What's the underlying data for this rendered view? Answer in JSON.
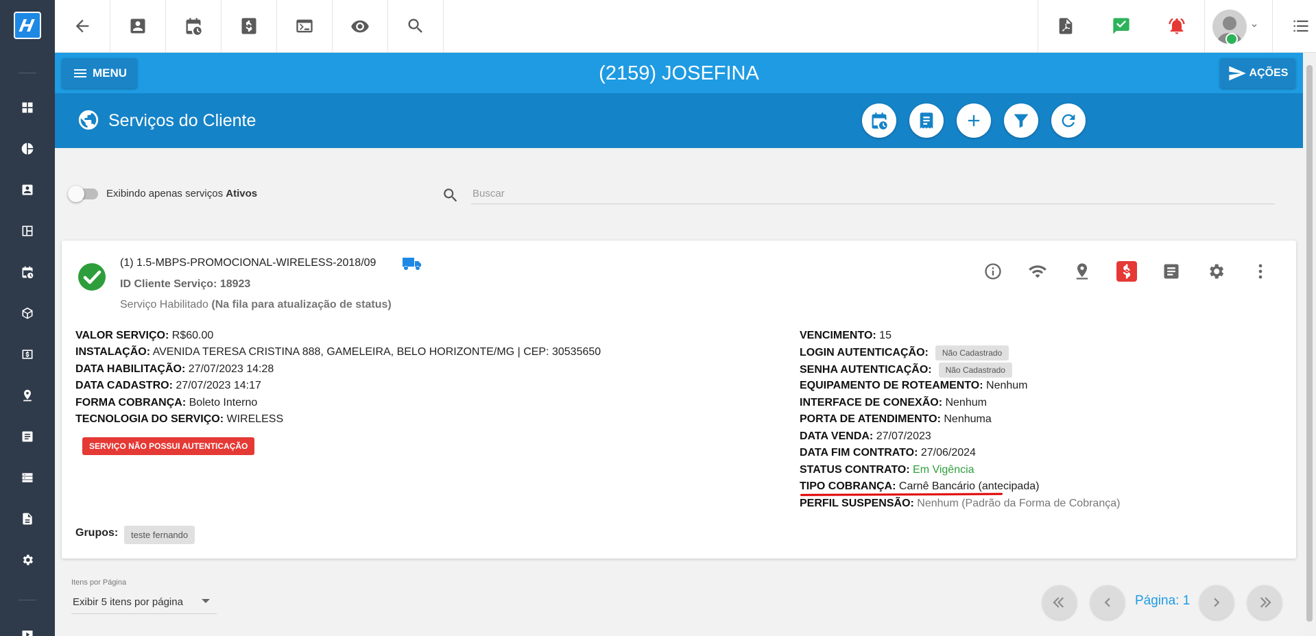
{
  "toolbar": {
    "buttons": [
      "back-icon",
      "contact-icon",
      "schedule-icon",
      "dollar-icon",
      "terminal-icon",
      "eye-icon",
      "search-icon"
    ],
    "right_buttons": [
      "pdf-icon",
      "task-check-icon",
      "alarm-icon"
    ]
  },
  "header": {
    "menu_label": "MENU",
    "client_title": "(2159) JOSEFINA",
    "actions_label": "AÇÕES"
  },
  "subheader": {
    "title": "Serviços do Cliente"
  },
  "filter": {
    "toggle_text": "Exibindo apenas serviços ",
    "toggle_bold": "Ativos",
    "search_placeholder": "Buscar"
  },
  "service": {
    "name": "(1) 1.5-MBPS-PROMOCIONAL-WIRELESS-2018/09",
    "id_line": "ID Cliente Serviço: 18923",
    "status_text": "Serviço Habilitado ",
    "status_bold": "(Na fila para atualização de status)",
    "left_fields": [
      {
        "label": "VALOR SERVIÇO:",
        "value": " R$60.00"
      },
      {
        "label": "INSTALAÇÃO:",
        "value": " AVENIDA TERESA CRISTINA 888, GAMELEIRA, BELO HORIZONTE/MG | CEP: 30535650"
      },
      {
        "label": "DATA HABILITAÇÃO:",
        "value": " 27/07/2023 14:28"
      },
      {
        "label": "DATA CADASTRO:",
        "value": " 27/07/2023 14:17"
      },
      {
        "label": "FORMA COBRANÇA:",
        "value": " Boleto Interno"
      },
      {
        "label": "TECNOLOGIA DO SERVIÇO:",
        "value": " WIRELESS"
      }
    ],
    "auth_warning": "SERVIÇO NÃO POSSUI AUTENTICAÇÃO",
    "right_fields": [
      {
        "label": "VENCIMENTO:",
        "value": " 15"
      },
      {
        "label": "LOGIN AUTENTICAÇÃO:",
        "value": "",
        "badge": "Não Cadastrado"
      },
      {
        "label": "SENHA AUTENTICAÇÃO:",
        "value": "",
        "badge": "Não Cadastrado"
      },
      {
        "label": "EQUIPAMENTO DE ROTEAMENTO:",
        "value": " Nenhum"
      },
      {
        "label": "INTERFACE DE CONEXÃO:",
        "value": " Nenhum"
      },
      {
        "label": "PORTA DE ATENDIMENTO:",
        "value": " Nenhuma"
      },
      {
        "label": "DATA VENDA:",
        "value": " 27/07/2023"
      },
      {
        "label": "DATA FIM CONTRATO:",
        "value": " 27/06/2024"
      },
      {
        "label": "STATUS CONTRATO:",
        "value": " Em Vigência"
      },
      {
        "label": "TIPO COBRANÇA:",
        "value": " Carnê Bancário (antecipada)"
      },
      {
        "label": "PERFIL SUSPENSÃO:",
        "value": " Nenhum (Padrão da Forma de Cobrança)"
      }
    ],
    "groups_label": "Grupos:",
    "group_badge": "teste fernando",
    "status_color": "#2e9e3c"
  },
  "footer": {
    "per_page_label": "Itens por Página",
    "per_page_value": "Exibir 5 itens por página",
    "page_label": "Página: 1"
  },
  "colors": {
    "primary": "#1e9be3",
    "primary_dark": "#1583c7",
    "sidebar": "#2f3a4a",
    "danger": "#e53935"
  }
}
